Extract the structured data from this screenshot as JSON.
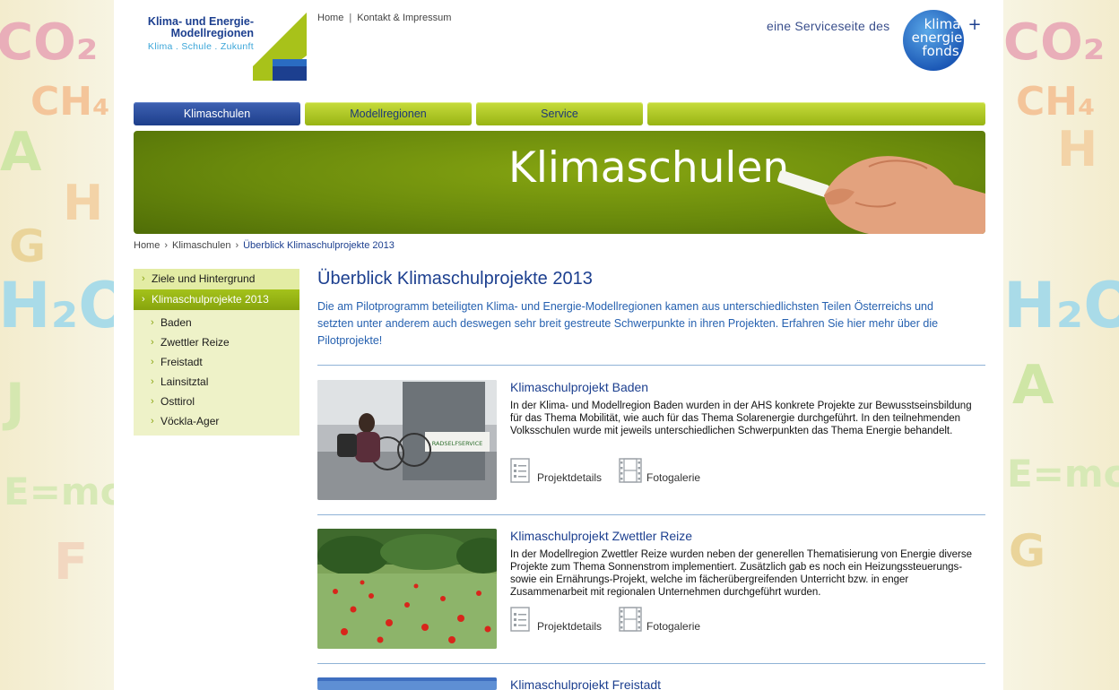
{
  "header": {
    "logo": {
      "line1": "Klima- und Energie-",
      "line2": "Modellregionen",
      "tagline": "Klima . Schule . Zukunft"
    },
    "topnav": {
      "home": "Home",
      "separator": "|",
      "kontakt": "Kontakt & Impressum"
    },
    "service_text": "eine Serviceseite des",
    "partner_logo": {
      "line1": "klima",
      "line2": "energie",
      "line3": "fonds",
      "plus": "+"
    }
  },
  "mainnav": {
    "items": [
      {
        "label": "Klimaschulen",
        "active": true
      },
      {
        "label": "Modellregionen",
        "active": false
      },
      {
        "label": "Service",
        "active": false
      },
      {
        "label": "",
        "active": false
      }
    ]
  },
  "banner": {
    "title": "Klimaschulen"
  },
  "breadcrumb": {
    "items": [
      "Home",
      "Klimaschulen",
      "Überblick Klimaschulprojekte 2013"
    ],
    "separator": "›"
  },
  "sidebar": {
    "chevron": "›",
    "items": [
      {
        "label": "Ziele und Hintergrund"
      },
      {
        "label": "Klimaschulprojekte 2013"
      }
    ],
    "subitems": [
      {
        "label": "Baden"
      },
      {
        "label": "Zwettler Reize"
      },
      {
        "label": "Freistadt"
      },
      {
        "label": "Lainsitztal"
      },
      {
        "label": "Osttirol"
      },
      {
        "label": "Vöckla-Ager"
      }
    ]
  },
  "main": {
    "title": "Überblick Klimaschulprojekte 2013",
    "intro": "Die am Pilotprogramm beteiligten Klima- und Energie-Modellregionen kamen aus unterschiedlichsten Teilen Österreichs und setzten unter anderem auch deswegen sehr breit gestreute Schwerpunkte in ihren Projekten. Erfahren Sie hier mehr über die Pilotprojekte!",
    "projects": [
      {
        "title": "Klimaschulprojekt Baden",
        "text": "In der Klima- und Modellregion Baden wurden in der AHS konkrete Projekte zur Bewusstseinsbildung für das Thema Mobilität, wie auch für das Thema Solarenergie durchgeführt. In den teilnehmenden Volksschulen wurde mit jeweils unterschiedlichen Schwerpunkten das Thema Energie behandelt.",
        "details_label": "Projektdetails",
        "gallery_label": "Fotogalerie",
        "sign_text": "RADSELFSERVICE"
      },
      {
        "title": "Klimaschulprojekt Zwettler Reize",
        "text": "In der Modellregion Zwettler Reize wurden neben der generellen Thematisierung von Energie diverse Projekte zum Thema Sonnenstrom implementiert. Zusätzlich gab es noch ein Heizungssteuerungs- sowie ein Ernährungs-Projekt, welche im fächerübergreifenden Unterricht bzw. in enger Zusammenarbeit mit regionalen Unternehmen durchgeführt wurden.",
        "details_label": "Projektdetails",
        "gallery_label": "Fotogalerie"
      },
      {
        "title": "Klimaschulprojekt Freistadt"
      }
    ]
  },
  "background": {
    "left_letters": [
      "CO₂",
      "CH₄",
      "H₂O",
      "E=mc²",
      "A",
      "H",
      "G",
      "J",
      "F"
    ],
    "right_letters": [
      "CO₂",
      "CH₄",
      "H₂O",
      "E=mc²",
      "A",
      "H",
      "G"
    ]
  },
  "colors": {
    "brand_blue": "#1c3f8f",
    "link_blue": "#2661b0",
    "nav_green": "#a4c21b",
    "banner_green": "#6a8a0c"
  }
}
